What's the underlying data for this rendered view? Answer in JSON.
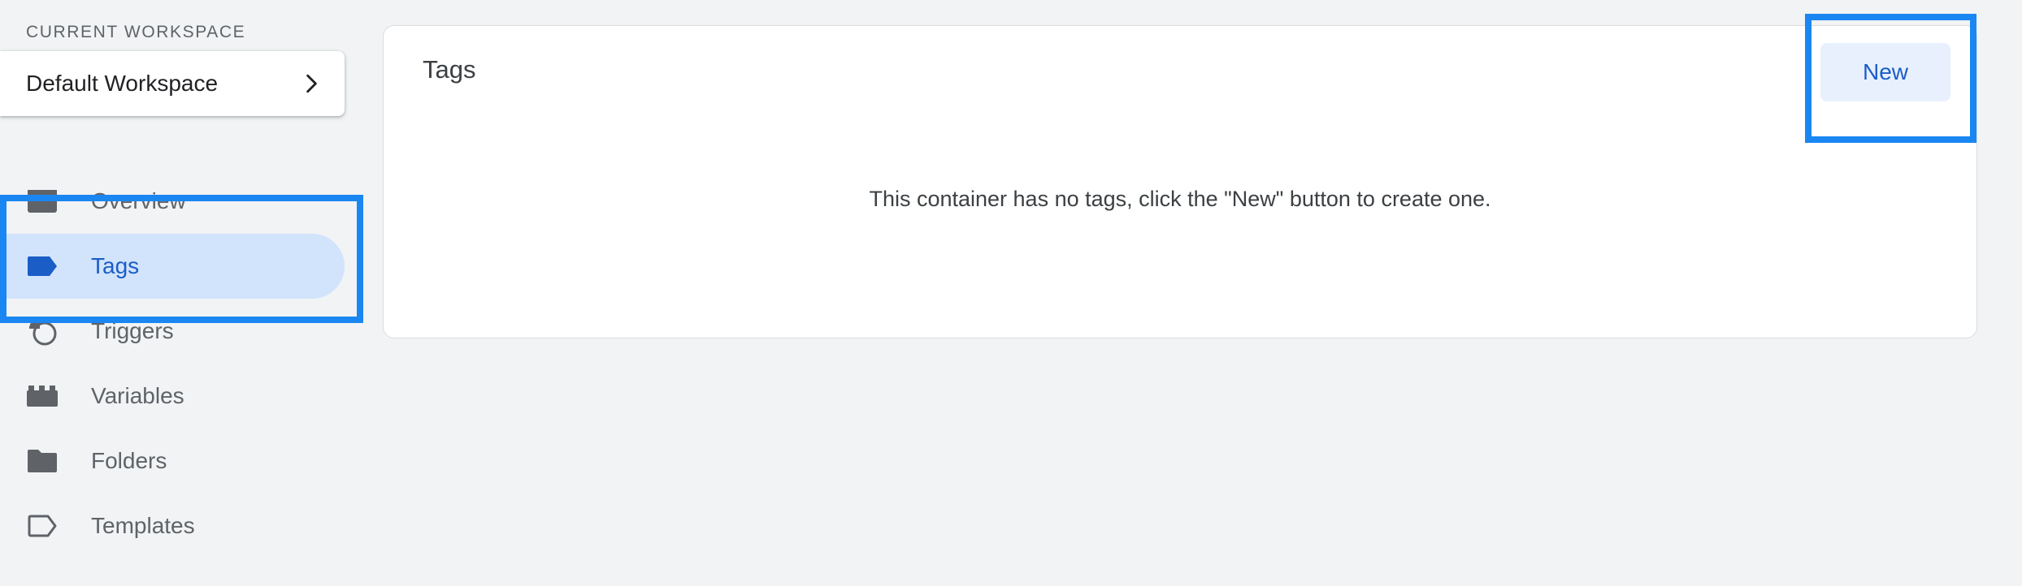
{
  "sidebar": {
    "workspace_label": "CURRENT WORKSPACE",
    "workspace_name": "Default Workspace",
    "items": [
      {
        "label": "Overview",
        "icon": "overview-icon"
      },
      {
        "label": "Tags",
        "icon": "tag-icon",
        "active": true
      },
      {
        "label": "Triggers",
        "icon": "trigger-icon"
      },
      {
        "label": "Variables",
        "icon": "variables-icon"
      },
      {
        "label": "Folders",
        "icon": "folder-icon"
      },
      {
        "label": "Templates",
        "icon": "template-icon"
      }
    ]
  },
  "main": {
    "title": "Tags",
    "new_button_label": "New",
    "empty_message": "This container has no tags, click the \"New\" button to create one."
  },
  "colors": {
    "accent": "#1a5dc7",
    "active_bg": "#d2e3fc",
    "highlight": "#1a86f2",
    "icon_gray": "#5f6368"
  }
}
